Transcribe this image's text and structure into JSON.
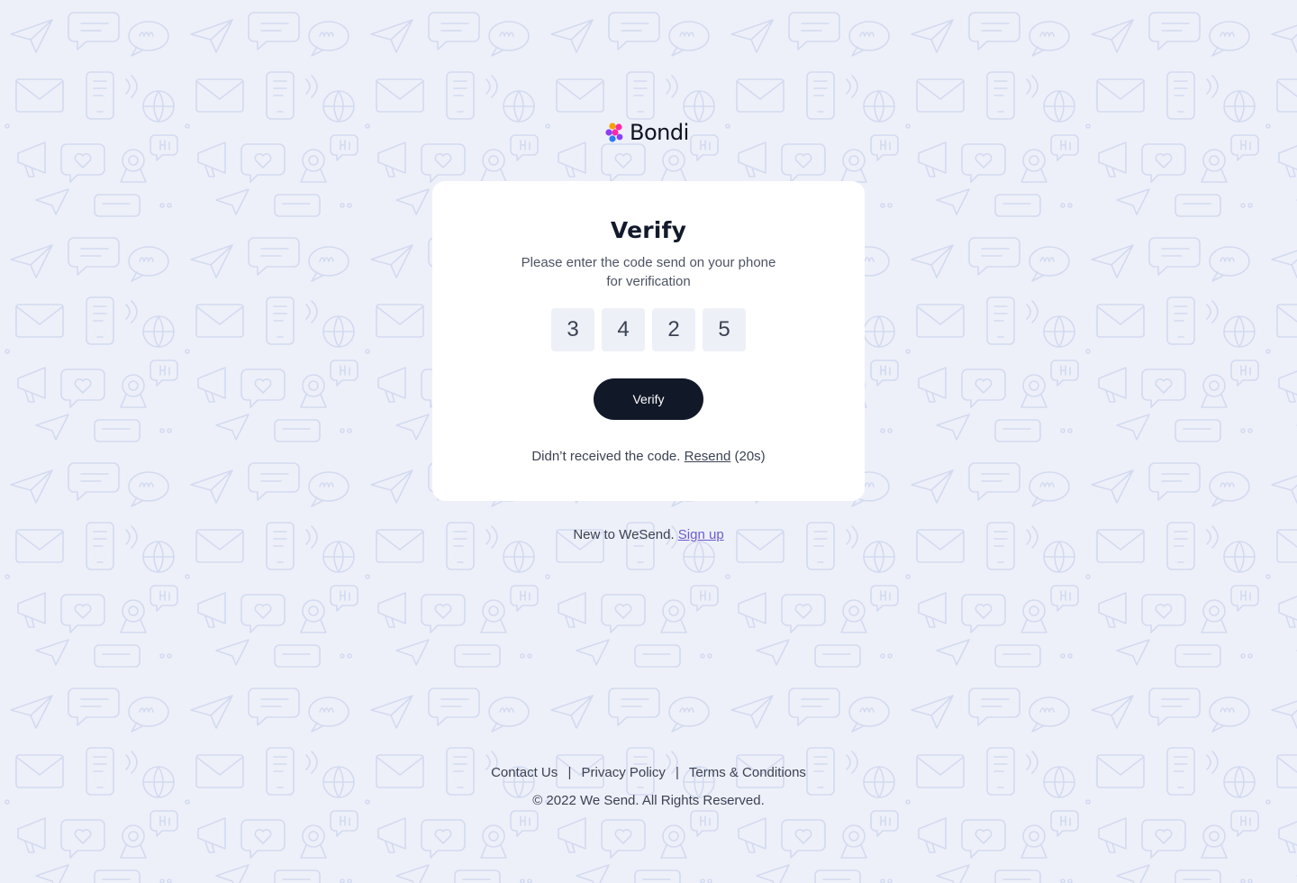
{
  "brand": {
    "name": "Bondi",
    "logo_icon": "bondi-dots-icon",
    "logo_colors": [
      "#f5a200",
      "#ff2aa6",
      "#8b3ff5",
      "#2e7bf6",
      "#00c2a8"
    ]
  },
  "card": {
    "title": "Verify",
    "subtitle_line1": "Please enter the code send on your phone",
    "subtitle_line2": "for verification",
    "code_digits": [
      "3",
      "4",
      "2",
      "5"
    ],
    "button_label": "Verify",
    "resend_prefix": "Didn’t received the code.",
    "resend_link": "Resend",
    "resend_timer": "(20s)"
  },
  "signup": {
    "prefix": "New to WeSend.",
    "link": "Sign up"
  },
  "footer": {
    "links": [
      "Contact Us",
      "Privacy Policy",
      "Terms & Conditions"
    ],
    "separator": "|",
    "copyright": "© 2022 We Send. All Rights Reserved."
  },
  "colors": {
    "background": "#eef0f9",
    "pattern_stroke": "#d3daf0",
    "primary_button": "#111827",
    "link_accent": "#6d5bd0"
  },
  "background_pattern_icons": [
    "paper-plane-icon",
    "speech-bubble-icon",
    "hello-bubble-icon",
    "hi-bubble-icon",
    "envelope-icon",
    "phone-icon",
    "globe-icon",
    "megaphone-icon",
    "heart-bubble-icon",
    "satellite-icon"
  ]
}
